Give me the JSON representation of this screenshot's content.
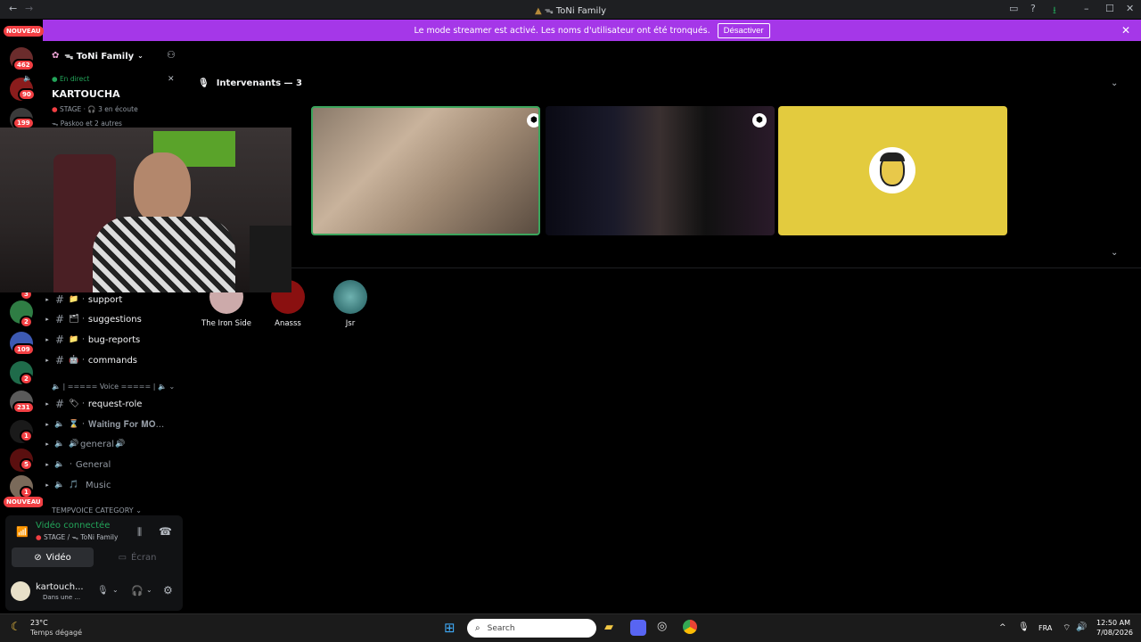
{
  "window": {
    "title": "ᯓ ToNi Family"
  },
  "banner": {
    "message": "Le mode streamer est activé. Les noms d'utilisateur ont été tronqués.",
    "disable_label": "Désactiver"
  },
  "rail": {
    "new_label_top": "NOUVEAU",
    "new_label_bottom": "NOUVEAU",
    "badges": [
      "462",
      "90",
      "199",
      "3",
      "2",
      "109",
      "2",
      "231",
      "1",
      "5",
      "1"
    ]
  },
  "sidebar": {
    "server_name": "ᯓ ToNi Family",
    "live_label": "En direct",
    "live_title": "KARTOUCHA",
    "stage_label": "STAGE",
    "listeners": "3 en écoute",
    "others": "ᯓ Paskoo et 2 autres",
    "channels": [
      {
        "name": "support",
        "emoji": "📁"
      },
      {
        "name": "suggestions",
        "emoji": "🗂"
      },
      {
        "name": "bug-reports",
        "emoji": "📁"
      },
      {
        "name": "commands",
        "emoji": "🤖"
      }
    ],
    "voice_category": "| ===== Voice ===== |",
    "request_role": "request-role",
    "voice_channels": [
      {
        "name": "𝐖𝐚𝐢𝐭𝐢𝐧𝐠 𝐅𝐨𝐫 𝐌𝐎...",
        "emoji": "⌛"
      },
      {
        "name": "general",
        "emoji": "🔊"
      },
      {
        "name": "General",
        "emoji": ""
      },
      {
        "name": "Music",
        "emoji": "🎵"
      }
    ],
    "tempvoice_category": "TEMPVOICE CATEGORY"
  },
  "voice_panel": {
    "status": "Vidéo connectée",
    "location": "STAGE / ᯓ ToNi Family",
    "video_label": "Vidéo",
    "screen_label": "Écran",
    "user_name": "kartouch...",
    "user_status": "Dans une ..."
  },
  "main": {
    "speakers_label": "Intervenants — 3",
    "audience": [
      {
        "name": "The Iron Side"
      },
      {
        "name": "Anasss"
      },
      {
        "name": "Jsr"
      }
    ]
  },
  "taskbar": {
    "temperature": "23°C",
    "weather": "Temps dégagé",
    "search_placeholder": "Search",
    "language": "FRA",
    "time": "12:50 AM",
    "date": "7/08/2026"
  },
  "colors": {
    "banner": "#a537e8",
    "connected_green": "#23a55a",
    "badge_red": "#f23f43",
    "speaking_border": "#3ba55c",
    "tile_yellow": "#e3cb3e"
  }
}
